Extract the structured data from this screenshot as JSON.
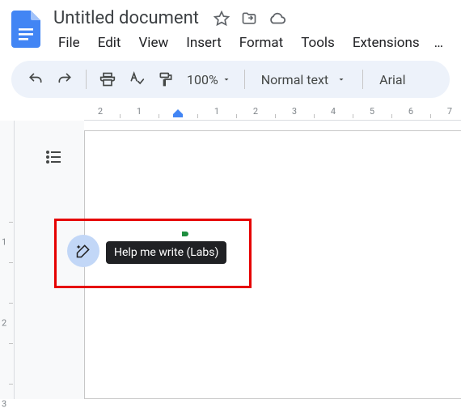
{
  "header": {
    "doc_title": "Untitled document"
  },
  "menu": {
    "file": "File",
    "edit": "Edit",
    "view": "View",
    "insert": "Insert",
    "format": "Format",
    "tools": "Tools",
    "extensions": "Extensions",
    "more": "…"
  },
  "toolbar": {
    "zoom": "100%",
    "paragraph_style": "Normal text",
    "font": "Arial"
  },
  "ruler": {
    "h_ticks": [
      "2",
      "1",
      "1",
      "2",
      "3",
      "4",
      "5",
      "6",
      "7"
    ],
    "v_ticks": [
      "1",
      "2",
      "3"
    ]
  },
  "tooltip": {
    "help_me_write": "Help me write (Labs)"
  }
}
